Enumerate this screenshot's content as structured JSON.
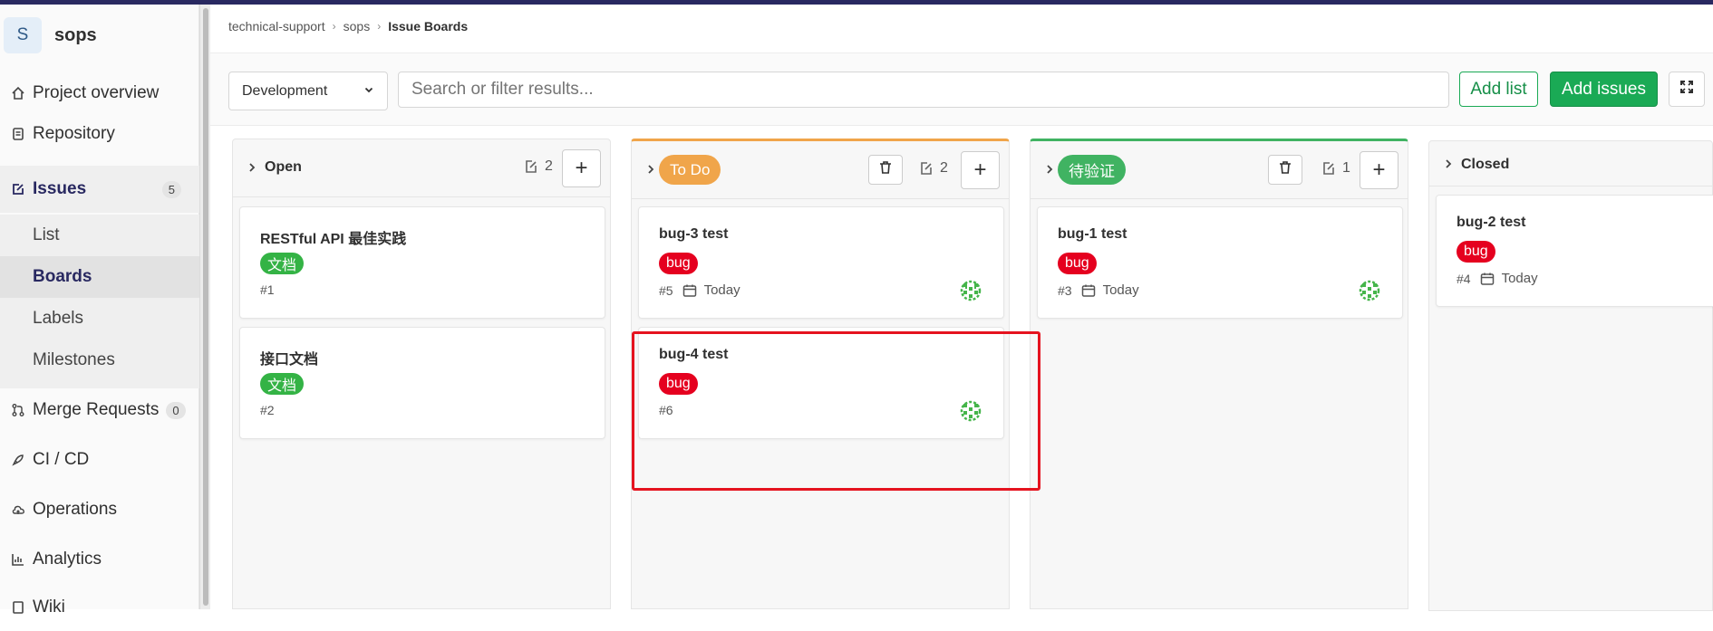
{
  "project": {
    "avatar": "S",
    "name": "sops"
  },
  "sidebar": {
    "items": [
      {
        "label": "Project overview",
        "icon": "home-icon"
      },
      {
        "label": "Repository",
        "icon": "doc-icon"
      },
      {
        "label": "Issues",
        "icon": "issues-icon",
        "count": "5"
      },
      {
        "label": "Merge Requests",
        "icon": "merge-icon",
        "count": "0"
      },
      {
        "label": "CI / CD",
        "icon": "rocket-icon"
      },
      {
        "label": "Operations",
        "icon": "cloud-icon"
      },
      {
        "label": "Analytics",
        "icon": "chart-icon"
      },
      {
        "label": "Wiki",
        "icon": "book-icon"
      }
    ],
    "issues_sub": [
      "List",
      "Boards",
      "Labels",
      "Milestones"
    ]
  },
  "breadcrumb": [
    "technical-support",
    "sops",
    "Issue Boards"
  ],
  "filter": {
    "board_select": "Development",
    "search_placeholder": "Search or filter results...",
    "add_list": "Add list",
    "add_issues": "Add issues"
  },
  "colors": {
    "accent": "#1aaa55",
    "todo": "#f0a54a",
    "verify": "#40b362",
    "bug": "#e5001f",
    "doc": "#34b345",
    "highlight": "#e5131f"
  },
  "lists": [
    {
      "title": "Open",
      "count": "2",
      "cards": [
        {
          "title": "RESTful API 最佳实践",
          "label": "文档",
          "number": "#1"
        },
        {
          "title": "接口文档",
          "label": "文档",
          "number": "#2"
        }
      ]
    },
    {
      "title": "To Do",
      "count": "2",
      "cards": [
        {
          "title": "bug-3 test",
          "label": "bug",
          "number": "#5",
          "due": "Today"
        },
        {
          "title": "bug-4 test",
          "label": "bug",
          "number": "#6"
        }
      ]
    },
    {
      "title": "待验证",
      "count": "1",
      "cards": [
        {
          "title": "bug-1 test",
          "label": "bug",
          "number": "#3",
          "due": "Today"
        }
      ]
    },
    {
      "title": "Closed",
      "cards": [
        {
          "title": "bug-2 test",
          "label": "bug",
          "number": "#4",
          "due": "Today"
        }
      ]
    }
  ]
}
